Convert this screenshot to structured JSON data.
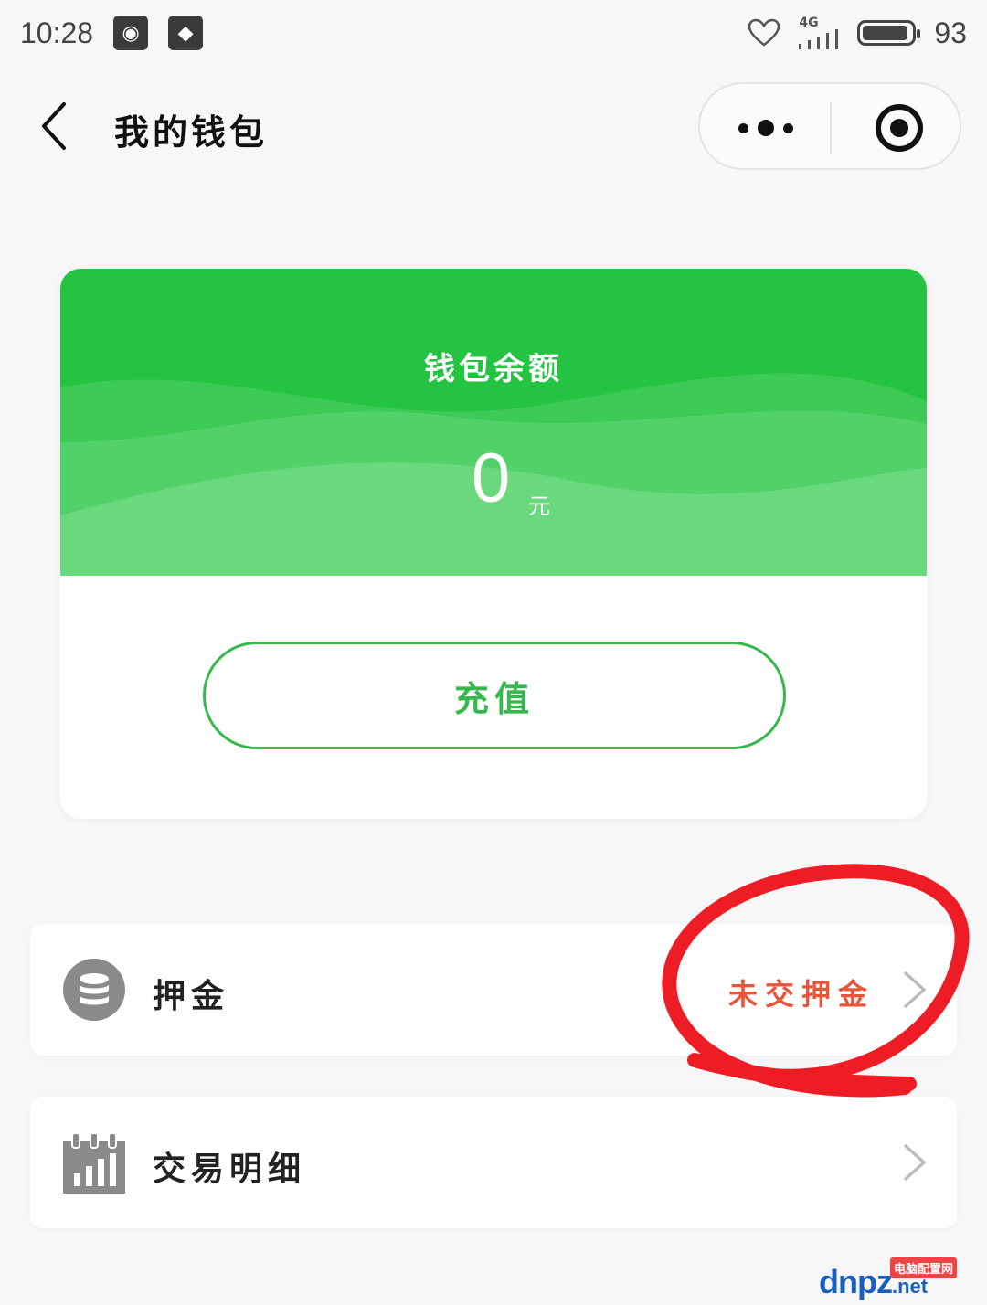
{
  "status_bar": {
    "time": "10:28",
    "network": "4G",
    "battery": "93",
    "battery_level": 0.93
  },
  "nav": {
    "title": "我的钱包",
    "icons": [
      "back-arrow-icon",
      "more-dots-icon",
      "close-target-icon"
    ]
  },
  "wallet": {
    "label": "钱包余额",
    "balance": "0",
    "unit": "元",
    "recharge_label": "充值"
  },
  "rows": [
    {
      "label": "押金",
      "value": "未交押金",
      "icon": "database-icon"
    },
    {
      "label": "交易明细",
      "icon": "calendar-chart-icon"
    }
  ],
  "watermark": {
    "main": "dnpz",
    "net": ".net",
    "badge": "电脑配置网"
  },
  "colors": {
    "primary_green": "#25c342",
    "button_green": "#36b84c",
    "deposit_value": "#e8553a",
    "annotation_red": "#ee1c24"
  }
}
